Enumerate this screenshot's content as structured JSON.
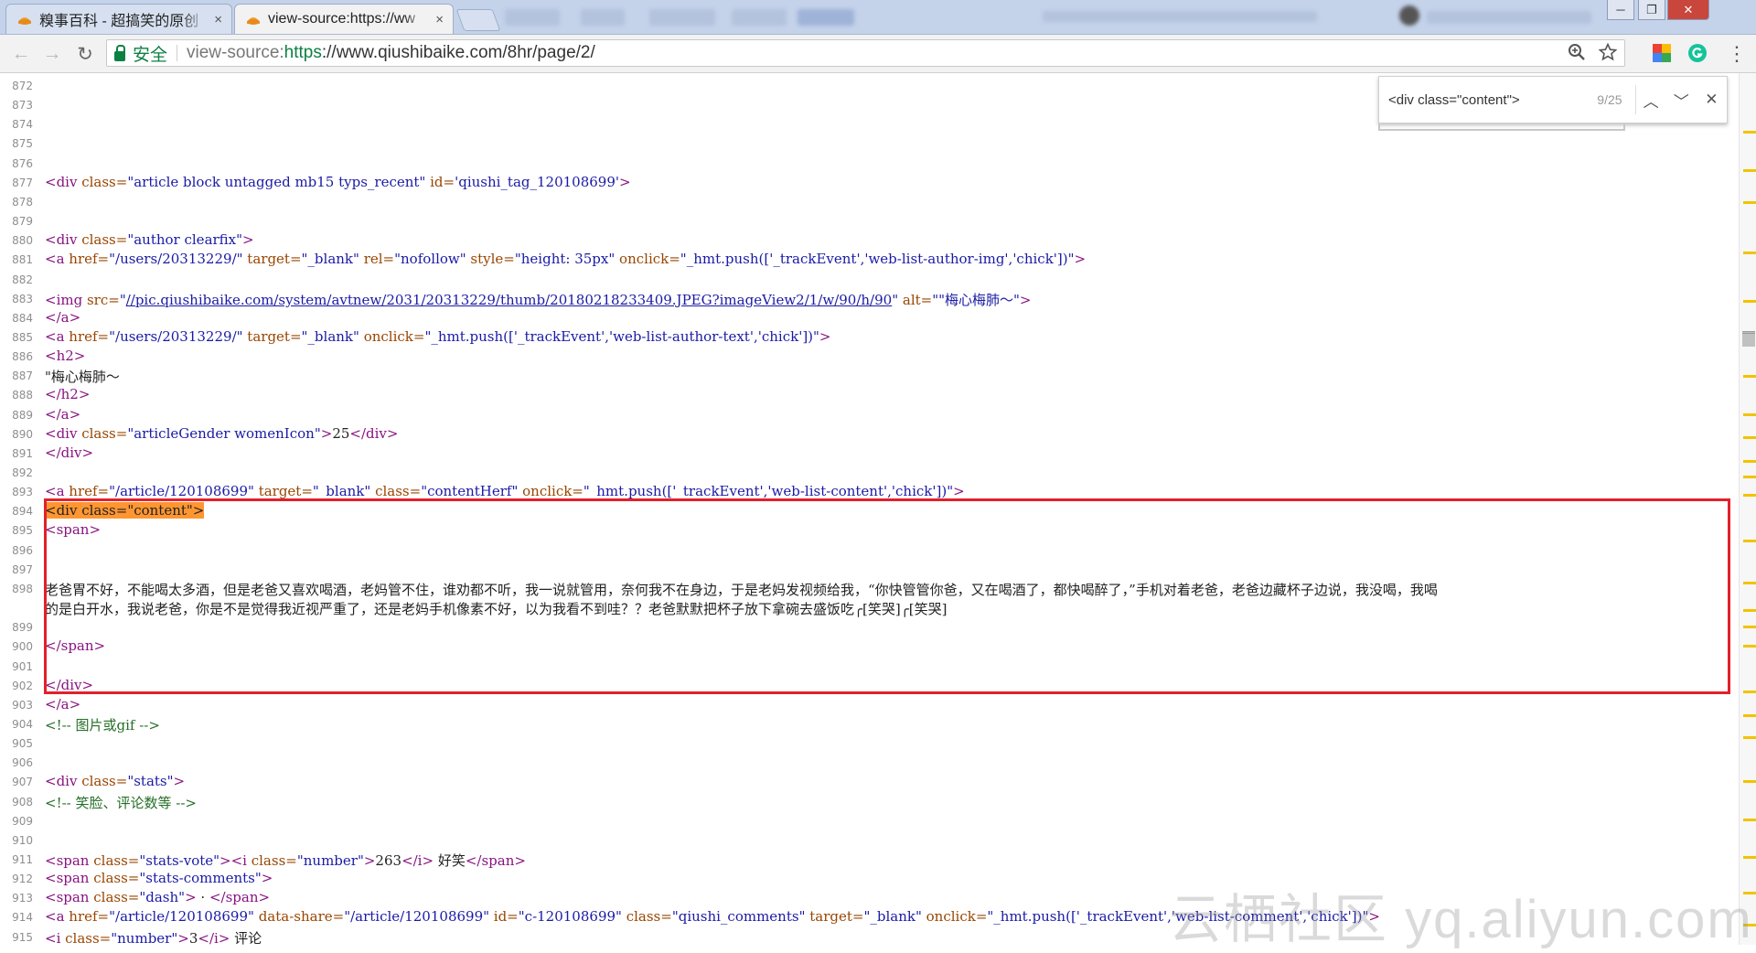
{
  "tabs": [
    {
      "title": "糗事百科 - 超搞笑的原创",
      "close": "×",
      "active": false
    },
    {
      "title": "view-source:https://ww",
      "close": "×",
      "active": true
    }
  ],
  "blurred_tab_labels": [
    "书签",
    "新手",
    "开发工具",
    "云服务",
    "图片工具"
  ],
  "window_controls": {
    "minimize": "─",
    "maximize": "❐",
    "close": "✕"
  },
  "toolbar": {
    "back": "←",
    "forward": "→",
    "reload": "↻",
    "secure_label": "安全",
    "url_scheme": "view-source:",
    "url_https": "https",
    "url_rest": "://www.qiushibaike.com/8hr/page/2/",
    "menu": "⋮"
  },
  "find": {
    "query": "<div class=\"content\">",
    "count": "9/25",
    "prev": "︿",
    "next": "﹀",
    "close": "✕"
  },
  "line_numbers": [
    "872",
    "873",
    "874",
    "875",
    "876",
    "877",
    "878",
    "879",
    "880",
    "881",
    "882",
    "883",
    "884",
    "885",
    "886",
    "887",
    "888",
    "889",
    "890",
    "891",
    "892",
    "893",
    "894",
    "895",
    "896",
    "897",
    "898",
    "",
    "899",
    "900",
    "901",
    "902",
    "903",
    "904",
    "905",
    "906",
    "907",
    "908",
    "909",
    "910",
    "911",
    "912",
    "913",
    "914",
    "915"
  ],
  "source_lines": [
    [],
    [],
    [],
    [],
    [],
    [
      [
        "t",
        "<div "
      ],
      [
        "a",
        "class="
      ],
      [
        "v",
        "\"article block untagged mb15 typs_recent\""
      ],
      [
        "a",
        " id="
      ],
      [
        "v",
        "'qiushi_tag_120108699'"
      ],
      [
        "t",
        ">"
      ]
    ],
    [],
    [],
    [
      [
        "t",
        "<div "
      ],
      [
        "a",
        "class="
      ],
      [
        "v",
        "\"author clearfix\""
      ],
      [
        "t",
        ">"
      ]
    ],
    [
      [
        "t",
        "<a "
      ],
      [
        "a",
        "href="
      ],
      [
        "v",
        "\"/users/20313229/\""
      ],
      [
        "a",
        " target="
      ],
      [
        "v",
        "\"_blank\""
      ],
      [
        "a",
        " rel="
      ],
      [
        "v",
        "\"nofollow\""
      ],
      [
        "a",
        " style="
      ],
      [
        "v",
        "\"height: 35px\""
      ],
      [
        "a",
        " onclick="
      ],
      [
        "v",
        "\"_hmt.push(['_trackEvent','web-list-author-img','chick'])\""
      ],
      [
        "t",
        ">"
      ]
    ],
    [],
    [
      [
        "t",
        "<img "
      ],
      [
        "a",
        "src="
      ],
      [
        "v",
        "\""
      ],
      [
        "k",
        "//pic.qiushibaike.com/system/avtnew/2031/20313229/thumb/20180218233409.JPEG?imageView2/1/w/90/h/90"
      ],
      [
        "v",
        "\""
      ],
      [
        "a",
        " alt="
      ],
      [
        "v",
        "\"\"梅心梅肺～\""
      ],
      [
        "t",
        ">"
      ]
    ],
    [
      [
        "t",
        "</a>"
      ]
    ],
    [
      [
        "t",
        "<a "
      ],
      [
        "a",
        "href="
      ],
      [
        "v",
        "\"/users/20313229/\""
      ],
      [
        "a",
        " target="
      ],
      [
        "v",
        "\"_blank\""
      ],
      [
        "a",
        " onclick="
      ],
      [
        "v",
        "\"_hmt.push(['_trackEvent','web-list-author-text','chick'])\""
      ],
      [
        "t",
        ">"
      ]
    ],
    [
      [
        "t",
        "<h2>"
      ]
    ],
    [
      [
        "x",
        "\"梅心梅肺～"
      ]
    ],
    [
      [
        "t",
        "</h2>"
      ]
    ],
    [
      [
        "t",
        "</a>"
      ]
    ],
    [
      [
        "t",
        "<div "
      ],
      [
        "a",
        "class="
      ],
      [
        "v",
        "\"articleGender womenIcon\""
      ],
      [
        "t",
        ">"
      ],
      [
        "x",
        "25"
      ],
      [
        "t",
        "</div>"
      ]
    ],
    [
      [
        "t",
        "</div>"
      ]
    ],
    [],
    [
      [
        "t",
        "<a "
      ],
      [
        "a",
        "href="
      ],
      [
        "v",
        "\"/article/120108699\""
      ],
      [
        "a",
        " target="
      ],
      [
        "v",
        "\"_blank\""
      ],
      [
        "a",
        " class="
      ],
      [
        "v",
        "\"contentHerf\""
      ],
      [
        "a",
        " onclick="
      ],
      [
        "v",
        "\"_hmt.push(['_trackEvent','web-list-content','chick'])\""
      ],
      [
        "t",
        ">"
      ]
    ],
    [
      [
        "h",
        "<div class=\"content\">"
      ]
    ],
    [
      [
        "t",
        "<span>"
      ]
    ],
    [],
    [],
    [
      [
        "x",
        "老爸胃不好，不能喝太多酒，但是老爸又喜欢喝酒，老妈管不住，谁劝都不听，我一说就管用，奈何我不在身边，于是老妈发视频给我，“你快管管你爸，又在喝酒了，都快喝醉了，”手机对着老爸，老爸边藏杯子边说，我没喝，我喝"
      ]
    ],
    [
      [
        "x",
        "的是白开水，我说老爸，你是不是觉得我近视严重了，还是老妈手机像素不好，以为我看不到哇？？老爸默默把杯子放下拿碗去盛饭吃╭[笑哭]╭[笑哭]"
      ]
    ],
    [],
    [
      [
        "t",
        "</span>"
      ]
    ],
    [],
    [
      [
        "t",
        "</div>"
      ]
    ],
    [
      [
        "t",
        "</a>"
      ]
    ],
    [
      [
        "c",
        "<!-- 图片或gif -->"
      ]
    ],
    [],
    [],
    [
      [
        "t",
        "<div "
      ],
      [
        "a",
        "class="
      ],
      [
        "v",
        "\"stats\""
      ],
      [
        "t",
        ">"
      ]
    ],
    [
      [
        "c",
        "<!-- 笑脸、评论数等 -->"
      ]
    ],
    [],
    [],
    [
      [
        "t",
        "<span "
      ],
      [
        "a",
        "class="
      ],
      [
        "v",
        "\"stats-vote\""
      ],
      [
        "t",
        "><i "
      ],
      [
        "a",
        "class="
      ],
      [
        "v",
        "\"number\""
      ],
      [
        "t",
        ">"
      ],
      [
        "x",
        "263"
      ],
      [
        "t",
        "</i>"
      ],
      [
        "x",
        " 好笑"
      ],
      [
        "t",
        "</span>"
      ]
    ],
    [
      [
        "t",
        "<span "
      ],
      [
        "a",
        "class="
      ],
      [
        "v",
        "\"stats-comments\""
      ],
      [
        "t",
        ">"
      ]
    ],
    [
      [
        "t",
        "<span "
      ],
      [
        "a",
        "class="
      ],
      [
        "v",
        "\"dash\""
      ],
      [
        "t",
        "> "
      ],
      [
        "x",
        "·"
      ],
      [
        "t",
        " </span>"
      ]
    ],
    [
      [
        "t",
        "<a "
      ],
      [
        "a",
        "href="
      ],
      [
        "v",
        "\"/article/120108699\""
      ],
      [
        "a",
        " data-share="
      ],
      [
        "v",
        "\"/article/120108699\""
      ],
      [
        "a",
        " id="
      ],
      [
        "v",
        "\"c-120108699\""
      ],
      [
        "a",
        " class="
      ],
      [
        "v",
        "\"qiushi_comments\""
      ],
      [
        "a",
        " target="
      ],
      [
        "v",
        "\"_blank\""
      ],
      [
        "a",
        " onclick="
      ],
      [
        "v",
        "\"_hmt.push(['_trackEvent','web-list-comment','chick'])\""
      ],
      [
        "t",
        ">"
      ]
    ],
    [
      [
        "t",
        "<i "
      ],
      [
        "a",
        "class="
      ],
      [
        "v",
        "\"number\""
      ],
      [
        "t",
        ">"
      ],
      [
        "x",
        "3"
      ],
      [
        "t",
        "</i>"
      ],
      [
        "x",
        " 评论"
      ]
    ]
  ],
  "watermark": "云栖社区 yq.aliyun.com",
  "colors": {
    "tag": "#881280",
    "attr_name": "#994500",
    "attr_value": "#1a1aa6",
    "comment": "#236e25",
    "find_highlight": "#ff9632",
    "annotation_box": "#e3202a",
    "secure_green": "#0b8043"
  }
}
